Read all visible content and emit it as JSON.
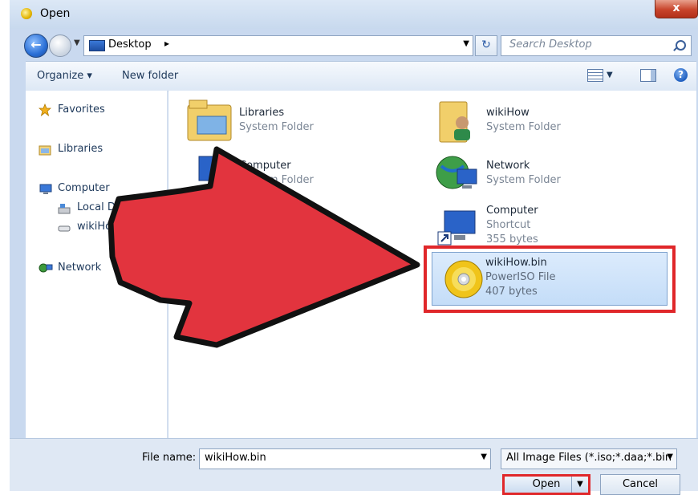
{
  "window": {
    "title": "Open",
    "close_label": "x"
  },
  "address": {
    "location": "Desktop",
    "search_placeholder": "Search Desktop"
  },
  "toolbar": {
    "organize_label": "Organize ▾",
    "new_folder_label": "New folder",
    "help_label": "?"
  },
  "sidebar": {
    "favorites": "Favorites",
    "libraries": "Libraries",
    "computer": "Computer",
    "local_disk": "Local Disk",
    "wikihow_drive": "wikiHow",
    "network": "Network"
  },
  "items": {
    "libraries": {
      "name": "Libraries",
      "type": "System Folder"
    },
    "wikihow": {
      "name": "wikiHow",
      "type": "System Folder"
    },
    "computer_folder": {
      "name": "Computer",
      "type": "System Folder"
    },
    "network": {
      "name": "Network",
      "type": "System Folder"
    },
    "computer_shortcut": {
      "name": "Computer",
      "type": "Shortcut",
      "size": "355 bytes"
    },
    "wikihow_bin": {
      "name": "wikiHow.bin",
      "type": "PowerISO File",
      "size": "407 bytes"
    }
  },
  "footer": {
    "file_name_label": "File name:",
    "file_name_value": "wikiHow.bin",
    "filter_value": "All Image Files (*.iso;*.daa;*.bin",
    "open_label": "Open",
    "cancel_label": "Cancel"
  },
  "colors": {
    "highlight_red": "#e0272a",
    "arrow_red": "#e2343e"
  }
}
